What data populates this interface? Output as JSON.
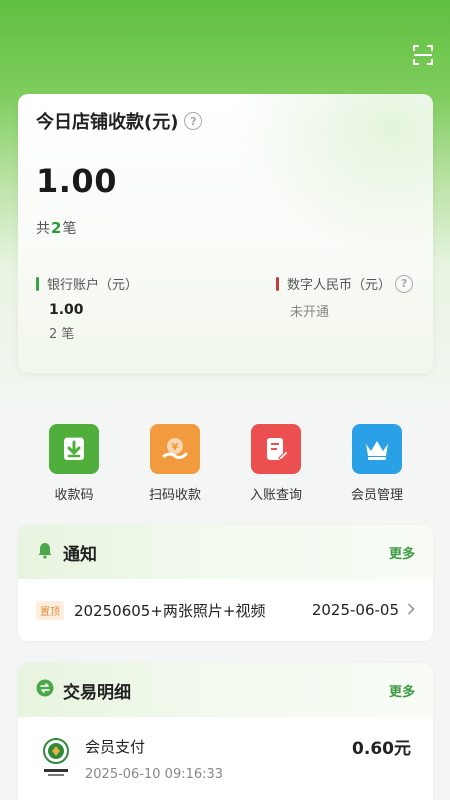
{
  "header": {
    "scan_icon": "scan-icon"
  },
  "summary": {
    "title": "今日店铺收款(元)",
    "help_glyph": "?",
    "amount": "1.00",
    "count_prefix": "共",
    "count": "2",
    "count_suffix": "笔",
    "bank": {
      "label": "银行账户（元）",
      "amount": "1.00",
      "count": "2 笔",
      "bar_color": "#3aa548"
    },
    "digital": {
      "label": "数字人民币（元）",
      "status": "未开通",
      "bar_color": "#c93b3b"
    }
  },
  "quick_actions": [
    {
      "label": "收款码",
      "icon": "qrcode-download-icon",
      "color": "#4fae3c"
    },
    {
      "label": "扫码收款",
      "icon": "yuan-hand-icon",
      "color": "#f19a3e"
    },
    {
      "label": "入账查询",
      "icon": "document-edit-icon",
      "color": "#ec4f4f"
    },
    {
      "label": "会员管理",
      "icon": "crown-icon",
      "color": "#2aa0e6"
    }
  ],
  "notice": {
    "title": "通知",
    "more": "更多",
    "items": [
      {
        "tag": "置顶",
        "text": "20250605+两张照片+视频",
        "date": "2025-06-05"
      }
    ]
  },
  "transactions": {
    "title": "交易明细",
    "more": "更多",
    "items": [
      {
        "title": "会员支付",
        "time": "2025-06-10 09:16:33",
        "amount": "0.60元"
      }
    ]
  }
}
